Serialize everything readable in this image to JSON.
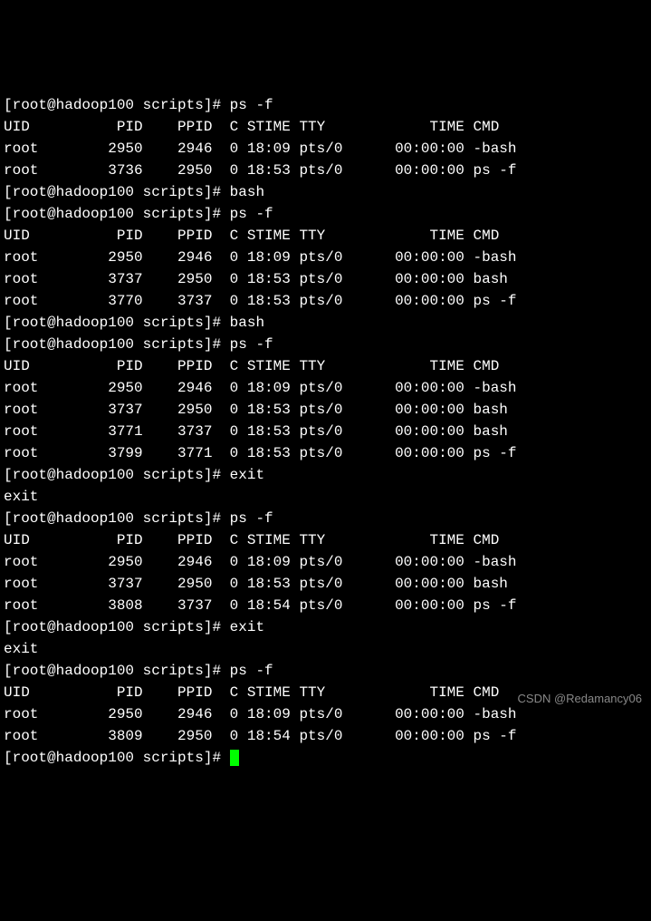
{
  "prompt": "[root@hadoop100 scripts]# ",
  "commands": {
    "psf": "ps -f",
    "bash": "bash",
    "exit": "exit"
  },
  "headers": {
    "uid": "UID",
    "pid": "PID",
    "ppid": "PPID",
    "c": "C",
    "stime": "STIME",
    "tty": "TTY",
    "time": "TIME",
    "cmd": "CMD"
  },
  "output1": [
    {
      "uid": "root",
      "pid": "2950",
      "ppid": "2946",
      "c": "0",
      "stime": "18:09",
      "tty": "pts/0",
      "time": "00:00:00",
      "cmd": "-bash"
    },
    {
      "uid": "root",
      "pid": "3736",
      "ppid": "2950",
      "c": "0",
      "stime": "18:53",
      "tty": "pts/0",
      "time": "00:00:00",
      "cmd": "ps -f"
    }
  ],
  "output2": [
    {
      "uid": "root",
      "pid": "2950",
      "ppid": "2946",
      "c": "0",
      "stime": "18:09",
      "tty": "pts/0",
      "time": "00:00:00",
      "cmd": "-bash"
    },
    {
      "uid": "root",
      "pid": "3737",
      "ppid": "2950",
      "c": "0",
      "stime": "18:53",
      "tty": "pts/0",
      "time": "00:00:00",
      "cmd": "bash"
    },
    {
      "uid": "root",
      "pid": "3770",
      "ppid": "3737",
      "c": "0",
      "stime": "18:53",
      "tty": "pts/0",
      "time": "00:00:00",
      "cmd": "ps -f"
    }
  ],
  "output3": [
    {
      "uid": "root",
      "pid": "2950",
      "ppid": "2946",
      "c": "0",
      "stime": "18:09",
      "tty": "pts/0",
      "time": "00:00:00",
      "cmd": "-bash"
    },
    {
      "uid": "root",
      "pid": "3737",
      "ppid": "2950",
      "c": "0",
      "stime": "18:53",
      "tty": "pts/0",
      "time": "00:00:00",
      "cmd": "bash"
    },
    {
      "uid": "root",
      "pid": "3771",
      "ppid": "3737",
      "c": "0",
      "stime": "18:53",
      "tty": "pts/0",
      "time": "00:00:00",
      "cmd": "bash"
    },
    {
      "uid": "root",
      "pid": "3799",
      "ppid": "3771",
      "c": "0",
      "stime": "18:53",
      "tty": "pts/0",
      "time": "00:00:00",
      "cmd": "ps -f"
    }
  ],
  "output4": [
    {
      "uid": "root",
      "pid": "2950",
      "ppid": "2946",
      "c": "0",
      "stime": "18:09",
      "tty": "pts/0",
      "time": "00:00:00",
      "cmd": "-bash"
    },
    {
      "uid": "root",
      "pid": "3737",
      "ppid": "2950",
      "c": "0",
      "stime": "18:53",
      "tty": "pts/0",
      "time": "00:00:00",
      "cmd": "bash"
    },
    {
      "uid": "root",
      "pid": "3808",
      "ppid": "3737",
      "c": "0",
      "stime": "18:54",
      "tty": "pts/0",
      "time": "00:00:00",
      "cmd": "ps -f"
    }
  ],
  "output5": [
    {
      "uid": "root",
      "pid": "2950",
      "ppid": "2946",
      "c": "0",
      "stime": "18:09",
      "tty": "pts/0",
      "time": "00:00:00",
      "cmd": "-bash"
    },
    {
      "uid": "root",
      "pid": "3809",
      "ppid": "2950",
      "c": "0",
      "stime": "18:54",
      "tty": "pts/0",
      "time": "00:00:00",
      "cmd": "ps -f"
    }
  ],
  "exit_echo": "exit",
  "watermark": "CSDN @Redamancy06"
}
